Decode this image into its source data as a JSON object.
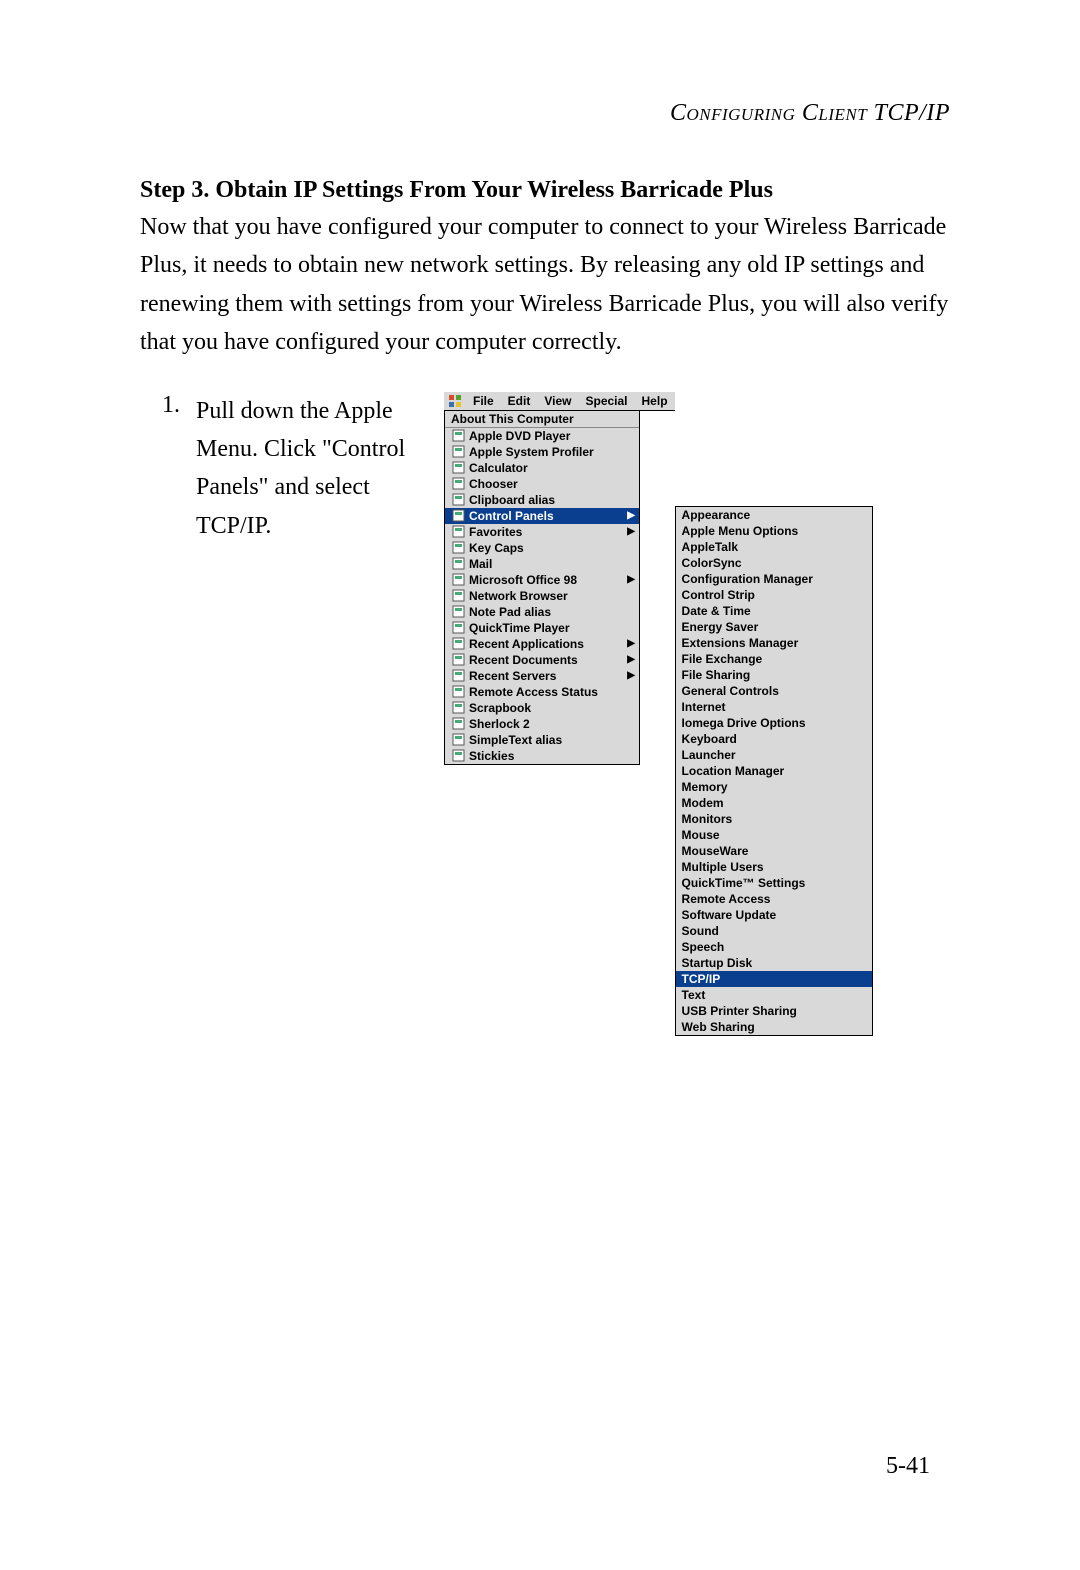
{
  "header": "Configuring Client TCP/IP",
  "step_title": "Step 3. Obtain IP Settings From Your Wireless Barricade Plus",
  "paragraph": "Now that you have configured your computer to connect to your Wireless Barricade Plus, it needs to obtain new network settings. By releasing any old IP settings and renewing them with settings from your Wireless Barricade Plus, you will also verify that you have configured your computer correctly.",
  "instruction": {
    "num": "1.",
    "text": "Pull down the Apple Menu. Click \"Control Panels\" and select TCP/IP."
  },
  "menubar": [
    "File",
    "Edit",
    "View",
    "Special",
    "Help"
  ],
  "apple_menu": {
    "top_item": "About This Computer",
    "items": [
      {
        "label": "Apple DVD Player",
        "arrow": false,
        "selected": false
      },
      {
        "label": "Apple System Profiler",
        "arrow": false,
        "selected": false
      },
      {
        "label": "Calculator",
        "arrow": false,
        "selected": false
      },
      {
        "label": "Chooser",
        "arrow": false,
        "selected": false
      },
      {
        "label": "Clipboard alias",
        "arrow": false,
        "selected": false
      },
      {
        "label": "Control Panels",
        "arrow": true,
        "selected": true
      },
      {
        "label": "Favorites",
        "arrow": true,
        "selected": false
      },
      {
        "label": "Key Caps",
        "arrow": false,
        "selected": false
      },
      {
        "label": "Mail",
        "arrow": false,
        "selected": false
      },
      {
        "label": "Microsoft Office 98",
        "arrow": true,
        "selected": false
      },
      {
        "label": "Network Browser",
        "arrow": false,
        "selected": false
      },
      {
        "label": "Note Pad alias",
        "arrow": false,
        "selected": false
      },
      {
        "label": "QuickTime Player",
        "arrow": false,
        "selected": false
      },
      {
        "label": "Recent Applications",
        "arrow": true,
        "selected": false
      },
      {
        "label": "Recent Documents",
        "arrow": true,
        "selected": false
      },
      {
        "label": "Recent Servers",
        "arrow": true,
        "selected": false
      },
      {
        "label": "Remote Access Status",
        "arrow": false,
        "selected": false
      },
      {
        "label": "Scrapbook",
        "arrow": false,
        "selected": false
      },
      {
        "label": "Sherlock 2",
        "arrow": false,
        "selected": false
      },
      {
        "label": "SimpleText alias",
        "arrow": false,
        "selected": false
      },
      {
        "label": "Stickies",
        "arrow": false,
        "selected": false
      }
    ]
  },
  "submenu": [
    {
      "label": "Appearance",
      "selected": false
    },
    {
      "label": "Apple Menu Options",
      "selected": false
    },
    {
      "label": "AppleTalk",
      "selected": false
    },
    {
      "label": "ColorSync",
      "selected": false
    },
    {
      "label": "Configuration Manager",
      "selected": false
    },
    {
      "label": "Control Strip",
      "selected": false
    },
    {
      "label": "Date & Time",
      "selected": false
    },
    {
      "label": "Energy Saver",
      "selected": false
    },
    {
      "label": "Extensions Manager",
      "selected": false
    },
    {
      "label": "File Exchange",
      "selected": false
    },
    {
      "label": "File Sharing",
      "selected": false
    },
    {
      "label": "General Controls",
      "selected": false
    },
    {
      "label": "Internet",
      "selected": false
    },
    {
      "label": "Iomega Drive Options",
      "selected": false
    },
    {
      "label": "Keyboard",
      "selected": false
    },
    {
      "label": "Launcher",
      "selected": false
    },
    {
      "label": "Location Manager",
      "selected": false
    },
    {
      "label": "Memory",
      "selected": false
    },
    {
      "label": "Modem",
      "selected": false
    },
    {
      "label": "Monitors",
      "selected": false
    },
    {
      "label": "Mouse",
      "selected": false
    },
    {
      "label": "MouseWare",
      "selected": false
    },
    {
      "label": "Multiple Users",
      "selected": false
    },
    {
      "label": "QuickTime™ Settings",
      "selected": false
    },
    {
      "label": "Remote Access",
      "selected": false
    },
    {
      "label": "Software Update",
      "selected": false
    },
    {
      "label": "Sound",
      "selected": false
    },
    {
      "label": "Speech",
      "selected": false
    },
    {
      "label": "Startup Disk",
      "selected": false
    },
    {
      "label": "TCP/IP",
      "selected": true
    },
    {
      "label": "Text",
      "selected": false
    },
    {
      "label": "USB Printer Sharing",
      "selected": false
    },
    {
      "label": "Web Sharing",
      "selected": false
    }
  ],
  "page_number": "5-41"
}
